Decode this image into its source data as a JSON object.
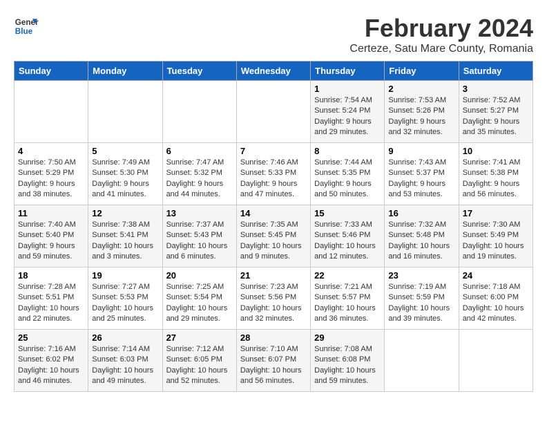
{
  "logo": {
    "line1": "General",
    "line2": "Blue"
  },
  "title": "February 2024",
  "subtitle": "Certeze, Satu Mare County, Romania",
  "days_of_week": [
    "Sunday",
    "Monday",
    "Tuesday",
    "Wednesday",
    "Thursday",
    "Friday",
    "Saturday"
  ],
  "weeks": [
    [
      {
        "day": "",
        "info": ""
      },
      {
        "day": "",
        "info": ""
      },
      {
        "day": "",
        "info": ""
      },
      {
        "day": "",
        "info": ""
      },
      {
        "day": "1",
        "info": "Sunrise: 7:54 AM\nSunset: 5:24 PM\nDaylight: 9 hours\nand 29 minutes."
      },
      {
        "day": "2",
        "info": "Sunrise: 7:53 AM\nSunset: 5:26 PM\nDaylight: 9 hours\nand 32 minutes."
      },
      {
        "day": "3",
        "info": "Sunrise: 7:52 AM\nSunset: 5:27 PM\nDaylight: 9 hours\nand 35 minutes."
      }
    ],
    [
      {
        "day": "4",
        "info": "Sunrise: 7:50 AM\nSunset: 5:29 PM\nDaylight: 9 hours\nand 38 minutes."
      },
      {
        "day": "5",
        "info": "Sunrise: 7:49 AM\nSunset: 5:30 PM\nDaylight: 9 hours\nand 41 minutes."
      },
      {
        "day": "6",
        "info": "Sunrise: 7:47 AM\nSunset: 5:32 PM\nDaylight: 9 hours\nand 44 minutes."
      },
      {
        "day": "7",
        "info": "Sunrise: 7:46 AM\nSunset: 5:33 PM\nDaylight: 9 hours\nand 47 minutes."
      },
      {
        "day": "8",
        "info": "Sunrise: 7:44 AM\nSunset: 5:35 PM\nDaylight: 9 hours\nand 50 minutes."
      },
      {
        "day": "9",
        "info": "Sunrise: 7:43 AM\nSunset: 5:37 PM\nDaylight: 9 hours\nand 53 minutes."
      },
      {
        "day": "10",
        "info": "Sunrise: 7:41 AM\nSunset: 5:38 PM\nDaylight: 9 hours\nand 56 minutes."
      }
    ],
    [
      {
        "day": "11",
        "info": "Sunrise: 7:40 AM\nSunset: 5:40 PM\nDaylight: 9 hours\nand 59 minutes."
      },
      {
        "day": "12",
        "info": "Sunrise: 7:38 AM\nSunset: 5:41 PM\nDaylight: 10 hours\nand 3 minutes."
      },
      {
        "day": "13",
        "info": "Sunrise: 7:37 AM\nSunset: 5:43 PM\nDaylight: 10 hours\nand 6 minutes."
      },
      {
        "day": "14",
        "info": "Sunrise: 7:35 AM\nSunset: 5:45 PM\nDaylight: 10 hours\nand 9 minutes."
      },
      {
        "day": "15",
        "info": "Sunrise: 7:33 AM\nSunset: 5:46 PM\nDaylight: 10 hours\nand 12 minutes."
      },
      {
        "day": "16",
        "info": "Sunrise: 7:32 AM\nSunset: 5:48 PM\nDaylight: 10 hours\nand 16 minutes."
      },
      {
        "day": "17",
        "info": "Sunrise: 7:30 AM\nSunset: 5:49 PM\nDaylight: 10 hours\nand 19 minutes."
      }
    ],
    [
      {
        "day": "18",
        "info": "Sunrise: 7:28 AM\nSunset: 5:51 PM\nDaylight: 10 hours\nand 22 minutes."
      },
      {
        "day": "19",
        "info": "Sunrise: 7:27 AM\nSunset: 5:53 PM\nDaylight: 10 hours\nand 25 minutes."
      },
      {
        "day": "20",
        "info": "Sunrise: 7:25 AM\nSunset: 5:54 PM\nDaylight: 10 hours\nand 29 minutes."
      },
      {
        "day": "21",
        "info": "Sunrise: 7:23 AM\nSunset: 5:56 PM\nDaylight: 10 hours\nand 32 minutes."
      },
      {
        "day": "22",
        "info": "Sunrise: 7:21 AM\nSunset: 5:57 PM\nDaylight: 10 hours\nand 36 minutes."
      },
      {
        "day": "23",
        "info": "Sunrise: 7:19 AM\nSunset: 5:59 PM\nDaylight: 10 hours\nand 39 minutes."
      },
      {
        "day": "24",
        "info": "Sunrise: 7:18 AM\nSunset: 6:00 PM\nDaylight: 10 hours\nand 42 minutes."
      }
    ],
    [
      {
        "day": "25",
        "info": "Sunrise: 7:16 AM\nSunset: 6:02 PM\nDaylight: 10 hours\nand 46 minutes."
      },
      {
        "day": "26",
        "info": "Sunrise: 7:14 AM\nSunset: 6:03 PM\nDaylight: 10 hours\nand 49 minutes."
      },
      {
        "day": "27",
        "info": "Sunrise: 7:12 AM\nSunset: 6:05 PM\nDaylight: 10 hours\nand 52 minutes."
      },
      {
        "day": "28",
        "info": "Sunrise: 7:10 AM\nSunset: 6:07 PM\nDaylight: 10 hours\nand 56 minutes."
      },
      {
        "day": "29",
        "info": "Sunrise: 7:08 AM\nSunset: 6:08 PM\nDaylight: 10 hours\nand 59 minutes."
      },
      {
        "day": "",
        "info": ""
      },
      {
        "day": "",
        "info": ""
      }
    ]
  ]
}
